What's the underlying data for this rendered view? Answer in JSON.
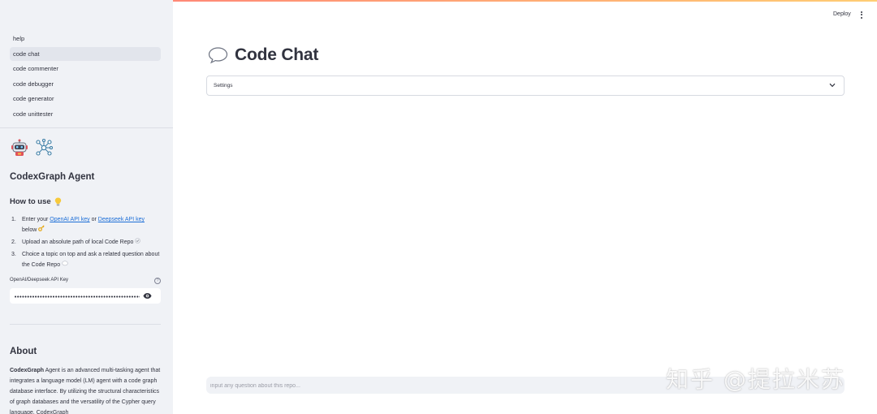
{
  "sidebar": {
    "nav": [
      {
        "label": "help",
        "active": false
      },
      {
        "label": "code chat",
        "active": true
      },
      {
        "label": "code commenter",
        "active": false
      },
      {
        "label": "code debugger",
        "active": false
      },
      {
        "label": "code generator",
        "active": false
      },
      {
        "label": "code unittester",
        "active": false
      }
    ],
    "agent_title": "CodexGraph Agent",
    "howto": {
      "title": "How to use",
      "steps": [
        {
          "num": "1.",
          "pre": "Enter your ",
          "link1": "OpenAI API key",
          "mid": " or ",
          "link2": "Deepseek API key",
          "post": " below"
        },
        {
          "num": "2.",
          "text": "Upload an absolute path of local Code Repo"
        },
        {
          "num": "3.",
          "text": "Choice a topic on top and ask a related question about the Code Repo"
        }
      ]
    },
    "api_key": {
      "label": "OpenAI/Deepseek API Key",
      "value": "••••••••••••••••••••••••••••••••••••••••••••••••••••"
    },
    "about": {
      "title": "About",
      "brand": "CodexGraph",
      "text": " Agent is an advanced multi-tasking agent that integrates a language model (LM) agent with a code graph database interface. By utilizing the structural characteristics of graph databases and the versatility of the Cypher query language, CodexGraph"
    }
  },
  "header": {
    "deploy": "Deploy"
  },
  "main": {
    "title": "Code Chat",
    "settings_label": "Settings",
    "chat_placeholder": "input any question about this repo..."
  },
  "watermark": "知乎 @提拉米苏",
  "colors": {
    "sidebar_bg": "#f0f2f6",
    "link": "#1c6ed7",
    "text": "#31333f",
    "accent_gradient_start": "#ff4b4b",
    "accent_gradient_end": "#ffbd45"
  }
}
